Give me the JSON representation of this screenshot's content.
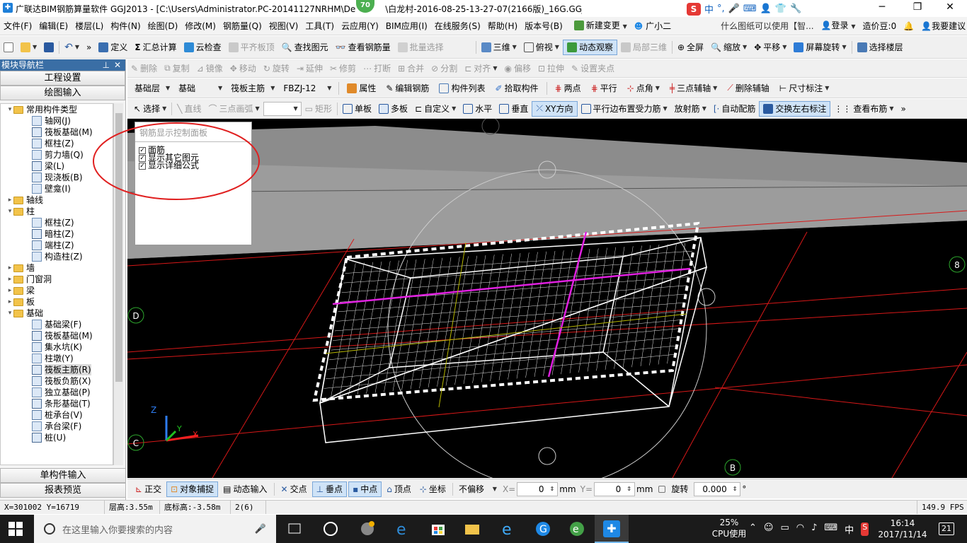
{
  "title": {
    "text": "广联达BIM钢筋算量软件 GGJ2013 - [C:\\Users\\Administrator.PC-20141127NRHM\\De",
    "text2": "\\白龙村-2016-08-25-13-27-07(2166版)_16G.GGJ12]",
    "badge": "70",
    "ime": [
      "中",
      "°,"
    ]
  },
  "menu": {
    "items": [
      "文件(F)",
      "编辑(E)",
      "楼层(L)",
      "构件(N)",
      "绘图(D)",
      "修改(M)",
      "钢筋量(Q)",
      "视图(V)",
      "工具(T)",
      "云应用(Y)",
      "BIM应用(I)",
      "在线服务(S)",
      "帮助(H)",
      "版本号(B)",
      "新建变更",
      "广小二"
    ],
    "ad": "什么图纸可以使用【智...",
    "login": "登录",
    "coins": "造价豆:0",
    "suggest": "我要建议"
  },
  "toolbar1": {
    "items": [
      "定义",
      "汇总计算",
      "云检查",
      "平齐板顶",
      "查找图元",
      "查看钢筋量",
      "批量选择",
      "三维",
      "俯视",
      "动态观察",
      "局部三维",
      "全屏",
      "缩放",
      "平移",
      "屏幕旋转",
      "选择楼层"
    ]
  },
  "toolbar2": {
    "items": [
      "删除",
      "复制",
      "镜像",
      "移动",
      "旋转",
      "延伸",
      "修剪",
      "打断",
      "合并",
      "分割",
      "对齐",
      "偏移",
      "拉伸",
      "设置夹点"
    ]
  },
  "toolbar3": {
    "layer": "基础层",
    "category": "基础",
    "component_type": "筏板主筋",
    "component": "FBZJ-12",
    "items": [
      "属性",
      "编辑钢筋",
      "构件列表",
      "拾取构件",
      "两点",
      "平行",
      "点角",
      "三点辅轴",
      "删除辅轴",
      "尺寸标注"
    ]
  },
  "toolbar4": {
    "items": [
      "选择",
      "直线",
      "三点画弧",
      "矩形",
      "单板",
      "多板",
      "自定义",
      "水平",
      "垂直",
      "XY方向",
      "平行边布置受力筋",
      "放射筋",
      "自动配筋",
      "交换左右标注",
      "查看布筋"
    ]
  },
  "left_panel": {
    "title": "模块导航栏",
    "btn_project": "工程设置",
    "btn_drawing": "绘图输入",
    "tree": [
      {
        "level": 0,
        "label": "常用构件类型",
        "folder": true,
        "open": true
      },
      {
        "level": 1,
        "label": "轴网(J)"
      },
      {
        "level": 1,
        "label": "筏板基础(M)"
      },
      {
        "level": 1,
        "label": "框柱(Z)"
      },
      {
        "level": 1,
        "label": "剪力墙(Q)"
      },
      {
        "level": 1,
        "label": "梁(L)"
      },
      {
        "level": 1,
        "label": "现浇板(B)"
      },
      {
        "level": 1,
        "label": "壁龛(I)"
      },
      {
        "level": 0,
        "label": "轴线",
        "folder": true
      },
      {
        "level": 0,
        "label": "柱",
        "folder": true,
        "open": true
      },
      {
        "level": 1,
        "label": "框柱(Z)"
      },
      {
        "level": 1,
        "label": "暗柱(Z)"
      },
      {
        "level": 1,
        "label": "端柱(Z)"
      },
      {
        "level": 1,
        "label": "构造柱(Z)"
      },
      {
        "level": 0,
        "label": "墙",
        "folder": true
      },
      {
        "level": 0,
        "label": "门窗洞",
        "folder": true
      },
      {
        "level": 0,
        "label": "梁",
        "folder": true
      },
      {
        "level": 0,
        "label": "板",
        "folder": true
      },
      {
        "level": 0,
        "label": "基础",
        "folder": true,
        "open": true
      },
      {
        "level": 1,
        "label": "基础梁(F)"
      },
      {
        "level": 1,
        "label": "筏板基础(M)"
      },
      {
        "level": 1,
        "label": "集水坑(K)"
      },
      {
        "level": 1,
        "label": "柱墩(Y)"
      },
      {
        "level": 1,
        "label": "筏板主筋(R)",
        "selected": true
      },
      {
        "level": 1,
        "label": "筏板负筋(X)"
      },
      {
        "level": 1,
        "label": "独立基础(P)"
      },
      {
        "level": 1,
        "label": "条形基础(T)"
      },
      {
        "level": 1,
        "label": "桩承台(V)"
      },
      {
        "level": 1,
        "label": "承台梁(F)"
      },
      {
        "level": 1,
        "label": "桩(U)"
      }
    ],
    "btn_single": "单构件输入",
    "btn_report": "报表预览"
  },
  "rebar_panel": {
    "title": "钢筋显示控制面板",
    "options": [
      {
        "label": "面筋",
        "checked": true
      },
      {
        "label": "显示其它图元",
        "checked": true
      },
      {
        "label": "显示详细公式",
        "checked": true
      }
    ]
  },
  "viewport": {
    "axis_labels": [
      "D",
      "C",
      "B",
      "8"
    ],
    "axis_gizmo": [
      "Z",
      "Y",
      "X"
    ]
  },
  "snapbar": {
    "items": [
      "正交",
      "对象捕捉",
      "动态输入",
      "交点",
      "垂点",
      "中点",
      "顶点",
      "坐标"
    ],
    "offset_mode": "不偏移",
    "x_label": "X=",
    "x_value": "0",
    "y_label": "Y=",
    "y_value": "0",
    "unit": "mm",
    "rotate_label": "旋转",
    "rotate_value": "0.000"
  },
  "status": {
    "coords": "X=301002 Y=16719",
    "floor_height": "层高:3.55m",
    "bottom_height": "底标高:-3.58m",
    "count": "2(6)",
    "fps": "149.9 FPS"
  },
  "taskbar": {
    "search_placeholder": "在这里输入你要搜索的内容",
    "cpu_percent": "25%",
    "cpu_label": "CPU使用",
    "ime": "中",
    "time": "16:14",
    "date": "2017/11/14",
    "notifications": "21"
  },
  "colors": {
    "accent": "#3a6ea5",
    "annotation_circle": "#e02020",
    "grid_red": "#d81818",
    "rebar_magenta": "#e020e0"
  }
}
